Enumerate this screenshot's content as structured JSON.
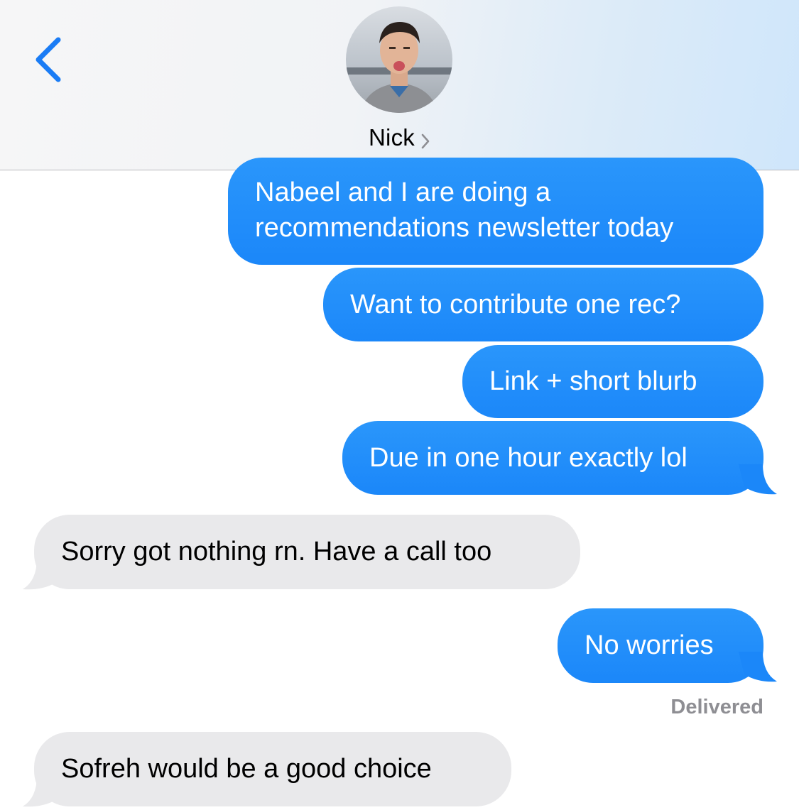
{
  "header": {
    "contact_name": "Nick",
    "back_icon": "chevron-left-icon",
    "details_icon": "chevron-right-icon",
    "accent_color": "#1a7cf5"
  },
  "messages": [
    {
      "direction": "outgoing",
      "lines": [
        "Nabeel and I are doing a",
        "recommendations newsletter today"
      ]
    },
    {
      "direction": "outgoing",
      "text": "Want to contribute one rec?"
    },
    {
      "direction": "outgoing",
      "text": "Link + short blurb"
    },
    {
      "direction": "outgoing",
      "text": "Due in one hour exactly lol"
    },
    {
      "direction": "incoming",
      "text": "Sorry got nothing rn. Have a call too"
    },
    {
      "direction": "outgoing",
      "text": "No worries"
    },
    {
      "direction": "incoming",
      "text": "Sofreh would be a good choice"
    }
  ],
  "status": {
    "delivered": "Delivered"
  },
  "colors": {
    "outgoing_bubble": "#1b87f9",
    "incoming_bubble": "#e9e9eb",
    "status_text": "#8e8e93"
  }
}
